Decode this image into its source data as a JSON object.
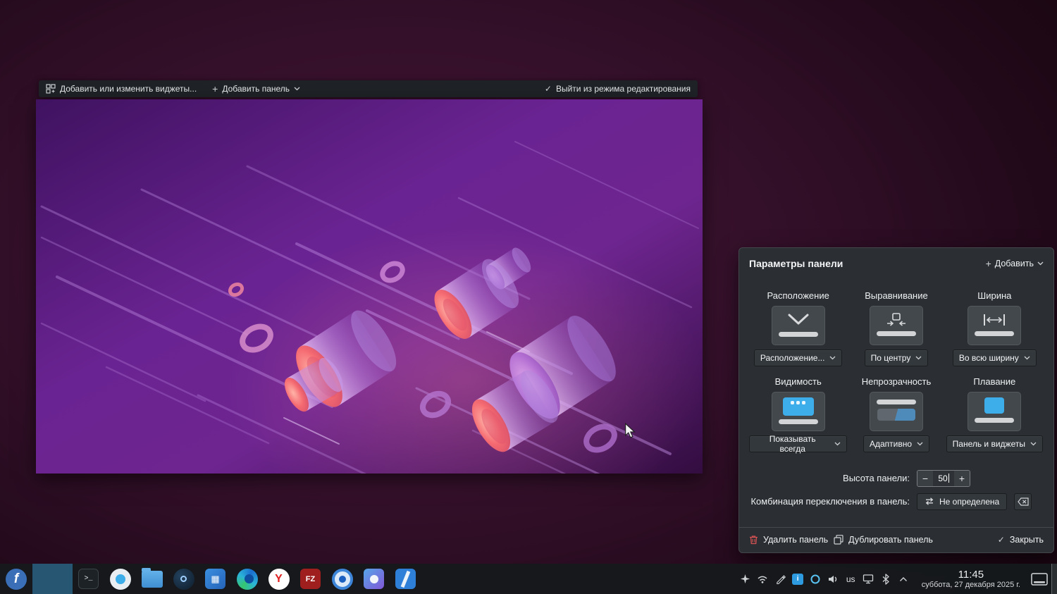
{
  "edit_bar": {
    "add_widgets_label": "Добавить или изменить виджеты...",
    "add_panel_label": "Добавить панель",
    "exit_label": "Выйти из режима редактирования"
  },
  "panel_dialog": {
    "title": "Параметры панели",
    "add_label": "Добавить",
    "groups": [
      {
        "label": "Расположение",
        "value": "Расположение..."
      },
      {
        "label": "Выравнивание",
        "value": "По центру"
      },
      {
        "label": "Ширина",
        "value": "Во всю ширину"
      },
      {
        "label": "Видимость",
        "value": "Показывать всегда"
      },
      {
        "label": "Непрозрачность",
        "value": "Адаптивно"
      },
      {
        "label": "Плавание",
        "value": "Панель и виджеты"
      }
    ],
    "height_label": "Высота панели:",
    "height_value": "50",
    "shortcut_label": "Комбинация переключения в панель:",
    "shortcut_value": "Не определена",
    "delete_label": "Удалить панель",
    "duplicate_label": "Дублировать панель",
    "close_label": "Закрыть"
  },
  "taskbar": {
    "time": "11:45",
    "date": "суббота, 27 декабря 2025 г.",
    "keyboard_layout": "us",
    "glyphs": {
      "fedora": "f",
      "terminal": ">_",
      "yandex": "Y",
      "filezilla": "FZ",
      "info": "i"
    }
  },
  "icons": {
    "plus": "+",
    "check": "✓",
    "minus": "−"
  },
  "colors": {
    "accent": "#3daee9",
    "dialog_bg": "#2b2f34",
    "panel_bg": "#16191c"
  }
}
